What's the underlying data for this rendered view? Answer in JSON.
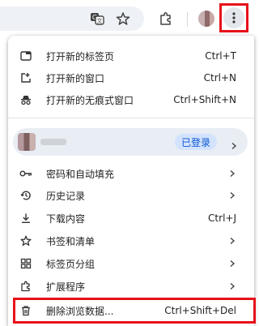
{
  "toolbar": {
    "icons": [
      "translate-icon",
      "star-icon",
      "extensions-icon",
      "profile-avatar",
      "more-vert-icon"
    ]
  },
  "menu": {
    "new_tab": {
      "label": "打开新的标签页",
      "shortcut": "Ctrl+T"
    },
    "new_window": {
      "label": "打开新的窗口",
      "shortcut": "Ctrl+N"
    },
    "incognito": {
      "label": "打开新的无痕式窗口",
      "shortcut": "Ctrl+Shift+N"
    },
    "profile": {
      "status": "已登录"
    },
    "passwords": {
      "label": "密码和自动填充"
    },
    "history": {
      "label": "历史记录"
    },
    "downloads": {
      "label": "下载内容",
      "shortcut": "Ctrl+J"
    },
    "bookmarks": {
      "label": "书签和清单"
    },
    "tab_groups": {
      "label": "标签页分组"
    },
    "extensions": {
      "label": "扩展程序"
    },
    "clear_data": {
      "label": "删除浏览数据...",
      "shortcut": "Ctrl+Shift+Del"
    }
  },
  "colors": {
    "highlight": "#e8111a",
    "badge_bg": "#d3e3fd",
    "badge_text": "#0b57d0"
  }
}
